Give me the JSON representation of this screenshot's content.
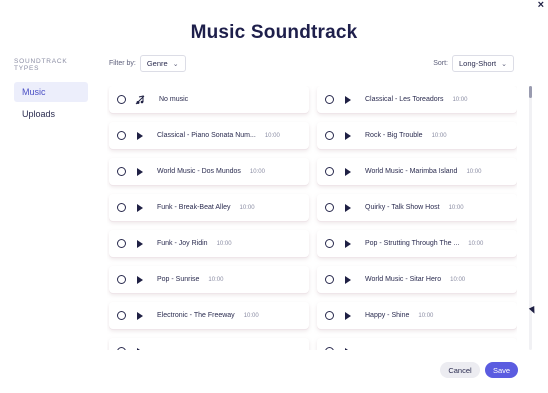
{
  "window": {
    "title": "Music Soundtrack",
    "close_label": "×"
  },
  "sidebar": {
    "heading": "SOUNDTRACK TYPES",
    "items": [
      {
        "label": "Music",
        "active": true
      },
      {
        "label": "Uploads",
        "active": false
      }
    ]
  },
  "filter": {
    "label": "Filter by:",
    "value": "Genre"
  },
  "sort": {
    "label": "Sort:",
    "value": "Long-Short"
  },
  "tracks": [
    {
      "name": "No music",
      "duration": "",
      "icon": "music-off-icon"
    },
    {
      "name": "Classical - Les Toreadors",
      "duration": "10:00",
      "icon": "play-icon"
    },
    {
      "name": "Classical - Piano Sonata Num...",
      "duration": "10:00",
      "icon": "play-icon"
    },
    {
      "name": "Rock - Big Trouble",
      "duration": "10:00",
      "icon": "play-icon"
    },
    {
      "name": "World Music - Dos Mundos",
      "duration": "10:00",
      "icon": "play-icon"
    },
    {
      "name": "World Music - Marimba Island",
      "duration": "10:00",
      "icon": "play-icon"
    },
    {
      "name": "Funk - Break-Beat Alley",
      "duration": "10:00",
      "icon": "play-icon"
    },
    {
      "name": "Quirky - Talk Show Host",
      "duration": "10:00",
      "icon": "play-icon"
    },
    {
      "name": "Funk - Joy Ridin",
      "duration": "10:00",
      "icon": "play-icon"
    },
    {
      "name": "Pop - Strutting Through The ...",
      "duration": "10:00",
      "icon": "play-icon"
    },
    {
      "name": "Pop - Sunrise",
      "duration": "10:00",
      "icon": "play-icon"
    },
    {
      "name": "World Music - Sitar Hero",
      "duration": "10:00",
      "icon": "play-icon"
    },
    {
      "name": "Electronic - The Freeway",
      "duration": "10:00",
      "icon": "play-icon"
    },
    {
      "name": "Happy - Shine",
      "duration": "10:00",
      "icon": "play-icon"
    },
    {
      "name": "",
      "duration": "",
      "icon": "play-icon"
    },
    {
      "name": "",
      "duration": "",
      "icon": "play-icon"
    }
  ],
  "footer": {
    "cancel_label": "Cancel",
    "save_label": "Save"
  },
  "colors": {
    "accent": "#5b5ce0",
    "title": "#1e1f4b",
    "active_bg": "#eceefb"
  }
}
